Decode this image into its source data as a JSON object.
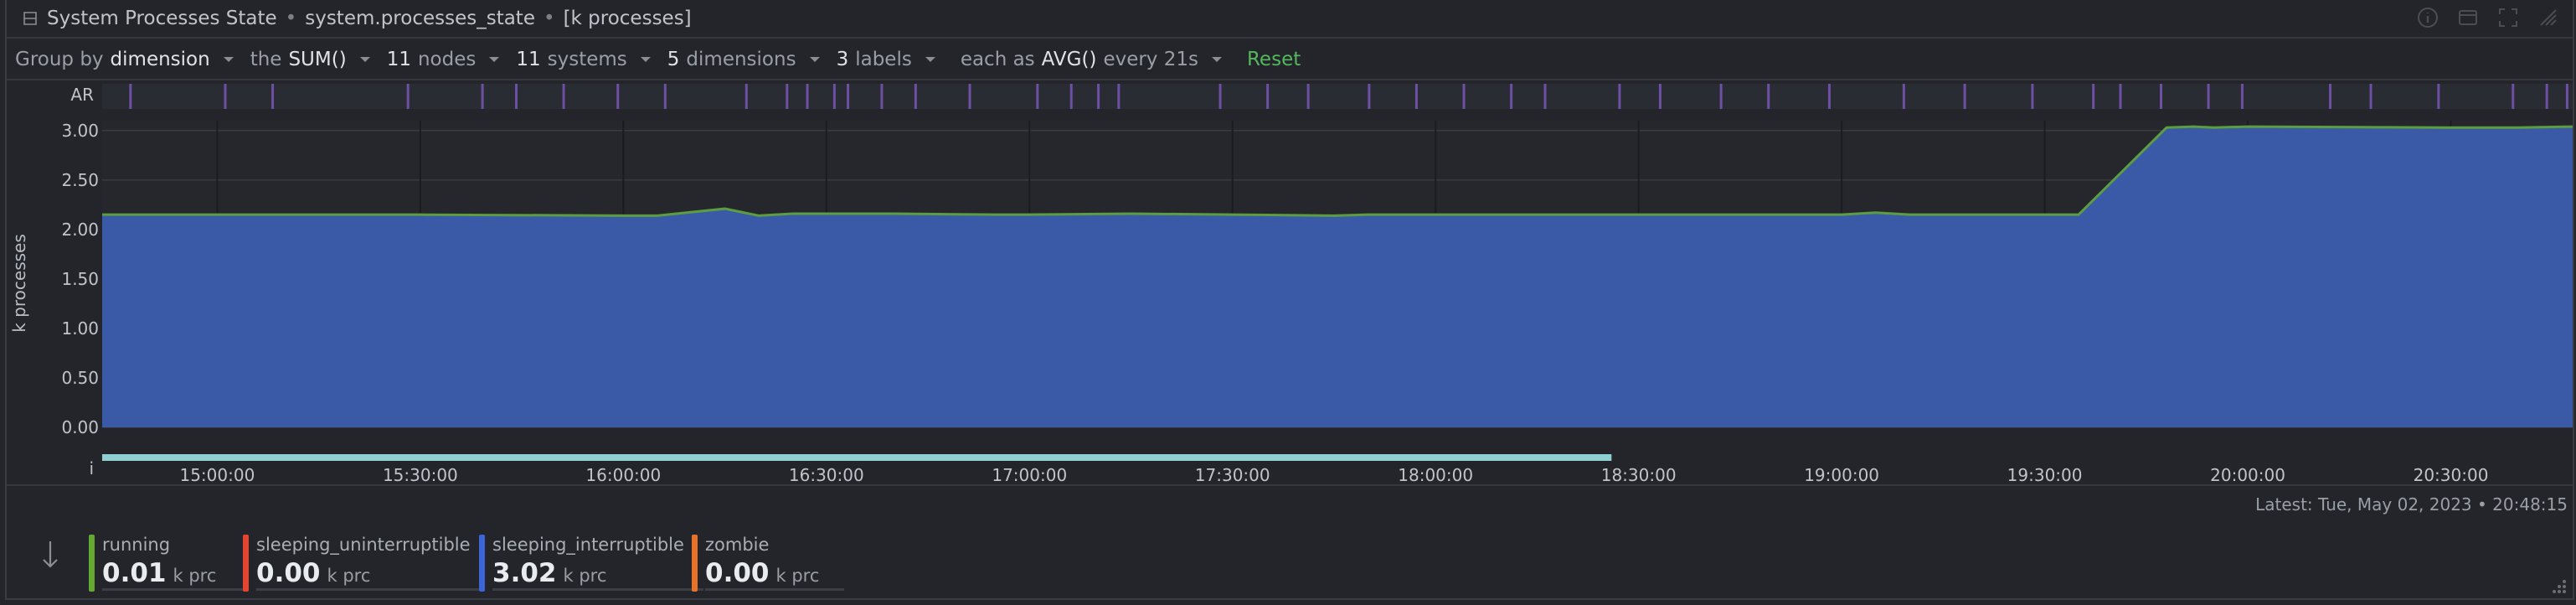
{
  "header": {
    "title": "System Processes State",
    "context": "system.processes_state",
    "units": "[k processes]",
    "separator": "•"
  },
  "toolbar": {
    "group_by_prefix": "Group by",
    "group_by_value": "dimension",
    "agg_prefix": "the",
    "agg_value": "SUM()",
    "nodes_count": "11",
    "nodes_label": "nodes",
    "systems_count": "11",
    "systems_label": "systems",
    "dimensions_count": "5",
    "dimensions_label": "dimensions",
    "labels_count": "3",
    "labels_label": "labels",
    "each_prefix": "each as",
    "each_value": "AVG()",
    "every_label": "every 21s",
    "reset_label": "Reset"
  },
  "latest": "Latest: Tue, May 02, 2023 • 20:48:15",
  "legend": [
    {
      "name": "running",
      "value": "0.01",
      "unit": "k prc",
      "color": "#63a833"
    },
    {
      "name": "sleeping_uninterruptible",
      "value": "0.00",
      "unit": "k prc",
      "color": "#e5452f"
    },
    {
      "name": "sleeping_interruptible",
      "value": "3.02",
      "unit": "k prc",
      "color": "#3c66d6"
    },
    {
      "name": "zombie",
      "value": "0.00",
      "unit": "k prc",
      "color": "#e8722a"
    }
  ],
  "colors": {
    "area": "#3a5aa8",
    "area_top": "#5b9d3f",
    "anomaly": "#6d4fa3",
    "info_bar": "#8fd0d2",
    "accent_green": "#53b85c"
  },
  "chart_data": {
    "type": "area",
    "ylabel": "k processes",
    "ylim": [
      0,
      3.1
    ],
    "yticks": [
      "0.00",
      "0.50",
      "1.00",
      "1.50",
      "2.00",
      "2.50",
      "3.00"
    ],
    "xticks": [
      "15:00:00",
      "15:30:00",
      "16:00:00",
      "16:30:00",
      "17:00:00",
      "17:30:00",
      "18:00:00",
      "18:30:00",
      "19:00:00",
      "19:30:00",
      "20:00:00",
      "20:30:00"
    ],
    "xrange_minutes": [
      -17,
      348
    ],
    "x_minutes": [
      -17,
      0,
      30,
      60,
      65,
      75,
      80,
      85,
      100,
      115,
      120,
      135,
      150,
      165,
      170,
      180,
      210,
      240,
      245,
      250,
      258,
      270,
      275,
      288,
      292,
      295,
      300,
      330,
      340,
      348
    ],
    "series": [
      {
        "name": "sleeping_interruptible",
        "values": [
          2.14,
          2.14,
          2.14,
          2.13,
          2.13,
          2.2,
          2.13,
          2.15,
          2.15,
          2.14,
          2.14,
          2.15,
          2.14,
          2.13,
          2.14,
          2.14,
          2.14,
          2.14,
          2.16,
          2.14,
          2.14,
          2.14,
          2.14,
          3.02,
          3.03,
          3.02,
          3.03,
          3.02,
          3.02,
          3.03
        ]
      },
      {
        "name": "running",
        "values": [
          0.01,
          0.01,
          0.01,
          0.01,
          0.01,
          0.01,
          0.01,
          0.01,
          0.01,
          0.01,
          0.01,
          0.01,
          0.01,
          0.01,
          0.01,
          0.01,
          0.01,
          0.01,
          0.01,
          0.01,
          0.01,
          0.01,
          0.01,
          0.01,
          0.01,
          0.01,
          0.01,
          0.01,
          0.01,
          0.01
        ]
      }
    ],
    "anomaly_label": "AR",
    "anomaly_minutes": [
      -13,
      1,
      8,
      28,
      39,
      44,
      51,
      59,
      66,
      78,
      84,
      87,
      91,
      93,
      98,
      103,
      111,
      121,
      126,
      130,
      133,
      148,
      155,
      161,
      170,
      177,
      184,
      191,
      196,
      207,
      213,
      222,
      229,
      238,
      249,
      258,
      268,
      277,
      281,
      287,
      294,
      299,
      312,
      318,
      328,
      339,
      344,
      347
    ],
    "info_label": "i",
    "info_range_minutes": [
      -17,
      206
    ],
    "grid": true
  }
}
